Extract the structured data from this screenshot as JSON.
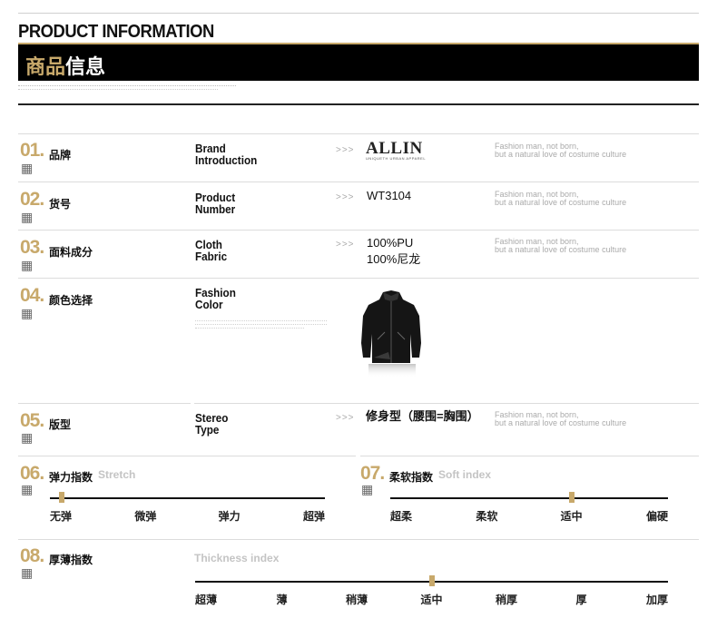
{
  "header": {
    "title_en": "PRODUCT INFORMATION",
    "title_cn_gold": "商品",
    "title_cn_white": "信息"
  },
  "hash_icon": "hash-grid-icon",
  "arrows": ">>>",
  "rows": {
    "brand": {
      "num": "01.",
      "cn": "品牌",
      "en1": "Brand",
      "en2": "Introduction",
      "logo": "ALLIN",
      "logo_sub": "UNIQUETH URBAN APPAREL",
      "slogan1": "Fashion man, not born,",
      "slogan2": "but a natural love of costume culture"
    },
    "number": {
      "num": "02.",
      "cn": "货号",
      "en1": "Product",
      "en2": "Number",
      "value": "WT3104",
      "slogan1": "Fashion man, not born,",
      "slogan2": "but a natural love of costume culture"
    },
    "fabric": {
      "num": "03.",
      "cn": "面料成分",
      "en1": "Cloth",
      "en2": "Fabric",
      "value1": "100%PU",
      "value2": "100%尼龙",
      "slogan1": "Fashion man, not born,",
      "slogan2": "but a natural love of costume culture"
    },
    "color": {
      "num": "04.",
      "cn": "颜色选择",
      "en1": "Fashion",
      "en2": "Color"
    },
    "type": {
      "num": "05.",
      "cn": "版型",
      "en1": "Stereo",
      "en2": "Type",
      "value": "修身型（腰围=胸围）",
      "slogan1": "Fashion man, not born,",
      "slogan2": "but a natural love of costume culture"
    }
  },
  "stretch": {
    "num": "06.",
    "cn": "弹力指数",
    "en": "Stretch",
    "labels": [
      "无弹",
      "微弹",
      "弹力",
      "超弹"
    ],
    "selected_index": 0
  },
  "soft": {
    "num": "07.",
    "cn": "柔软指数",
    "en": "Soft index",
    "labels": [
      "超柔",
      "柔软",
      "适中",
      "偏硬"
    ],
    "selected_index": 2
  },
  "thickness": {
    "num": "08.",
    "cn": "厚薄指数",
    "en": "Thickness index",
    "labels": [
      "超薄",
      "薄",
      "稍薄",
      "适中",
      "稍厚",
      "厚",
      "加厚"
    ],
    "selected_index": 3
  },
  "colors": {
    "gold": "#c8a96b",
    "black": "#000000"
  }
}
